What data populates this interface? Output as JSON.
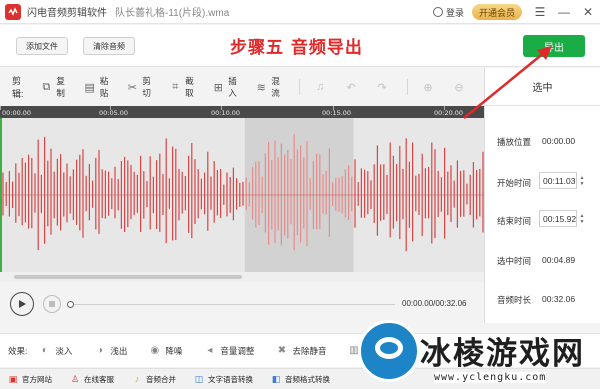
{
  "titlebar": {
    "app_name": "闪电音频剪辑软件",
    "file_title": "队长薔礼格-11(片段).wma",
    "login_label": "登录",
    "vip_label": "开通会员",
    "menu_icon": "menu-icon",
    "minimize_icon": "minimize-icon",
    "close_icon": "close-icon"
  },
  "actionbar": {
    "add_file_label": "添加文件",
    "clear_audio_label": "清除音频",
    "step_title": "步骤五 音频导出",
    "export_label": "导出"
  },
  "toolbar": {
    "label": "剪辑:",
    "tools": [
      {
        "name": "copy",
        "label": "复制",
        "icon": "copy-icon",
        "enabled": true
      },
      {
        "name": "paste",
        "label": "粘贴",
        "icon": "paste-icon",
        "enabled": true
      },
      {
        "name": "cut",
        "label": "剪切",
        "icon": "scissors-icon",
        "enabled": true
      },
      {
        "name": "crop",
        "label": "截取",
        "icon": "crop-icon",
        "enabled": true
      },
      {
        "name": "insert",
        "label": "插入",
        "icon": "insert-icon",
        "enabled": true
      },
      {
        "name": "mix",
        "label": "混流",
        "icon": "mix-icon",
        "enabled": true
      }
    ]
  },
  "timeline": {
    "ticks": [
      "00:00.00",
      "00:05.00",
      "00:10.00",
      "00:15.00",
      "00:20.00"
    ]
  },
  "waveform": {
    "selection_start": "00:11.03",
    "selection_end": "00:15.92",
    "total_duration": "00:32.06",
    "colors": {
      "wave": "#d94444",
      "wave_selected": "#e88b8b",
      "background": "#e7e7e7",
      "selection_bg": "#d2d2d2",
      "playhead": "#3cb043"
    }
  },
  "playback": {
    "time_readout": "00:00.00/00:32.06"
  },
  "rightpanel": {
    "header": "选中",
    "play_position_label": "播放位置",
    "play_position_value": "00:00.00",
    "start_label": "开始时间",
    "start_value": "00:11.03",
    "end_label": "结束时间",
    "end_value": "00:15.92",
    "selected_label": "选中时间",
    "selected_value": "00:04.89",
    "duration_label": "音频时长",
    "duration_value": "00:32.06"
  },
  "effects": {
    "label": "效果:",
    "items": [
      {
        "label": "淡入",
        "icon": "fade-in-icon"
      },
      {
        "label": "浅出",
        "icon": "fade-out-icon"
      },
      {
        "label": "降噪",
        "icon": "denoise-icon"
      },
      {
        "label": "音量调整",
        "icon": "volume-icon"
      },
      {
        "label": "去除静音",
        "icon": "mute-remove-icon"
      }
    ]
  },
  "statusbar": {
    "items": [
      {
        "label": "官方网站",
        "icon": "website-icon"
      },
      {
        "label": "在线客服",
        "icon": "support-icon"
      },
      {
        "label": "音频合并",
        "icon": "merge-icon"
      },
      {
        "label": "文字语音转换",
        "icon": "tts-icon"
      },
      {
        "label": "音频格式转换",
        "icon": "format-icon"
      }
    ]
  },
  "watermark": {
    "text": "冰棱游戏网",
    "url": "www.yclengku.com"
  }
}
